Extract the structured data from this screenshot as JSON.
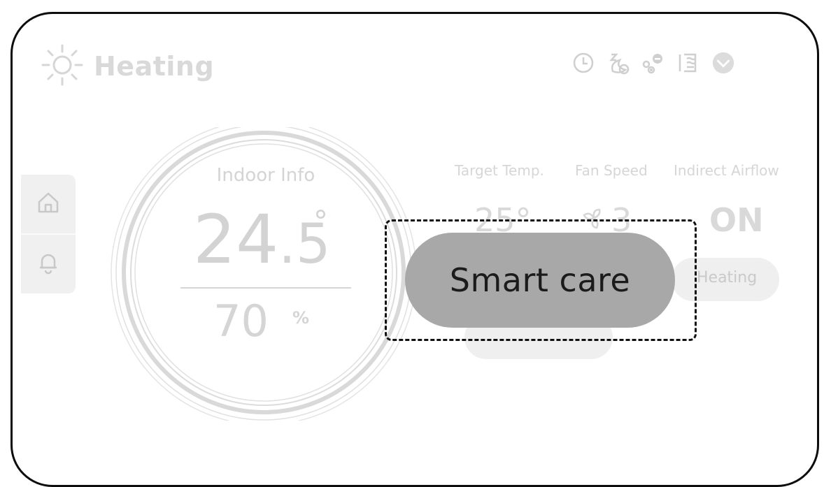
{
  "header": {
    "mode_title": "Heating",
    "mode_icon": "sun-icon"
  },
  "top_icons": [
    "timer-icon",
    "sleep-icon",
    "fan-adjust-icon",
    "airflow-icon",
    "chevron-down-icon"
  ],
  "sidebar": {
    "items": [
      {
        "icon": "home-icon"
      },
      {
        "icon": "bell-icon"
      }
    ]
  },
  "indoor": {
    "label": "Indoor Info",
    "temp_int": "24",
    "temp_dec": ".5",
    "temp_unit": "°",
    "humidity": "70",
    "humidity_unit": "%"
  },
  "stats": {
    "target_temp": {
      "label": "Target Temp.",
      "value": "25°"
    },
    "fan_speed": {
      "label": "Fan Speed",
      "value": "3",
      "icon": "fan-icon"
    },
    "indirect_airflow": {
      "label": "Indirect Airflow",
      "value": "ON"
    }
  },
  "mode_pill": {
    "label": "Heating"
  },
  "overlay": {
    "button_label": "Smart care"
  },
  "colors": {
    "frame": "#0d0d0d",
    "button_fill": "#a8a8a8",
    "faded_text": "#d9d9d9"
  }
}
